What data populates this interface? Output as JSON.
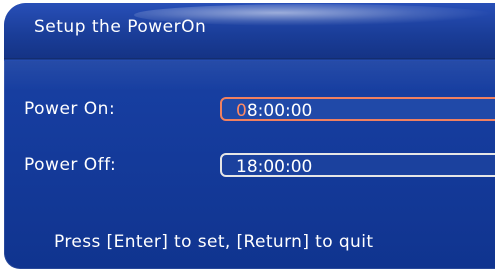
{
  "dialog": {
    "title": "Setup the PowerOn"
  },
  "power_on": {
    "label": "Power On:",
    "value_first_char": "0",
    "value_rest": "8:00:00"
  },
  "power_off": {
    "label": "Power Off:",
    "value": "18:00:00"
  },
  "hint": {
    "text": "Press [Enter] to set, [Return] to quit"
  },
  "colors": {
    "panel_blue": "#163d9f",
    "text": "#ffffff",
    "focus_border": "#f08060",
    "cursor_char": "#ff8a65"
  }
}
